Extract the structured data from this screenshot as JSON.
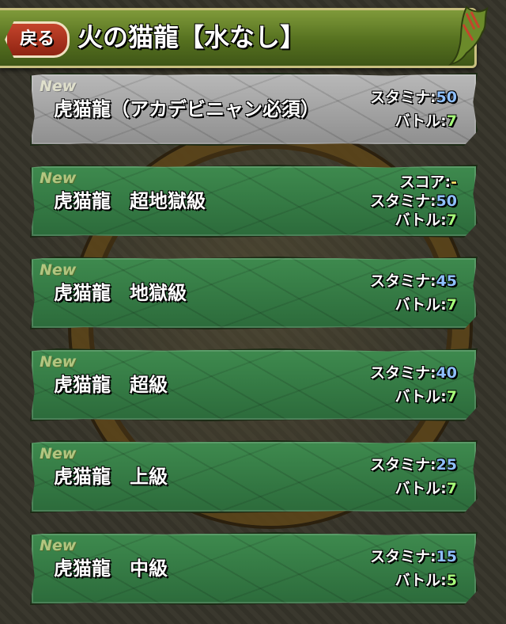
{
  "header": {
    "back_label": "戻る",
    "title": "火の猫龍【水なし】"
  },
  "dungeons": [
    {
      "new": "New",
      "name": "虎猫龍（アカデビニャン必須）",
      "stamina_label": "スタミナ:",
      "stamina": "50",
      "battle_label": "バトル:",
      "battle": "7",
      "style": "gray"
    },
    {
      "new": "New",
      "name": "虎猫龍　超地獄級",
      "score_label": "スコア:",
      "score": "-",
      "stamina_label": "スタミナ:",
      "stamina": "50",
      "battle_label": "バトル:",
      "battle": "7",
      "style": "green"
    },
    {
      "new": "New",
      "name": "虎猫龍　地獄級",
      "stamina_label": "スタミナ:",
      "stamina": "45",
      "battle_label": "バトル:",
      "battle": "7",
      "style": "green"
    },
    {
      "new": "New",
      "name": "虎猫龍　超級",
      "stamina_label": "スタミナ:",
      "stamina": "40",
      "battle_label": "バトル:",
      "battle": "7",
      "style": "green"
    },
    {
      "new": "New",
      "name": "虎猫龍　上級",
      "stamina_label": "スタミナ:",
      "stamina": "25",
      "battle_label": "バトル:",
      "battle": "7",
      "style": "green"
    },
    {
      "new": "New",
      "name": "虎猫龍　中級",
      "stamina_label": "スタミナ:",
      "stamina": "15",
      "battle_label": "バトル:",
      "battle": "5",
      "style": "green"
    }
  ],
  "colors": {
    "stamina_value": "#8fc0ff",
    "battle_value": "#a6ff7a",
    "score_value": "#ffe36a"
  }
}
